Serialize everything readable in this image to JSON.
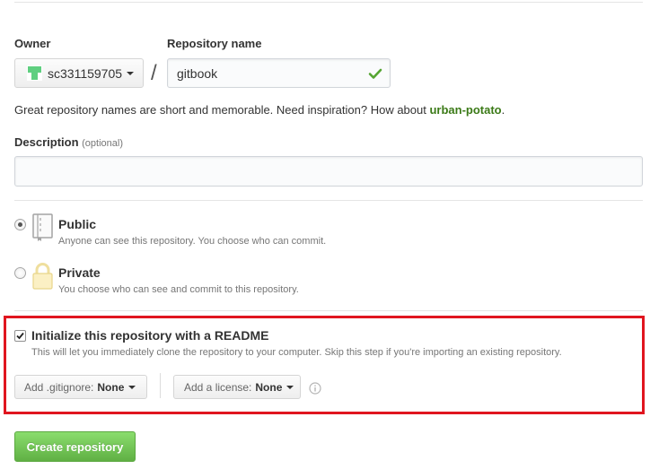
{
  "owner": {
    "label": "Owner",
    "selected": "sc331159705",
    "icon": "identicon-icon",
    "avatar_color": "#5fcf80"
  },
  "separator": "/",
  "repo_name": {
    "label": "Repository name",
    "value": "gitbook",
    "valid_icon": "check-icon",
    "valid_color": "#55a532"
  },
  "suggestion": {
    "text": "Great repository names are short and memorable. Need inspiration? How about ",
    "name": "urban-potato",
    "end": "."
  },
  "description": {
    "label": "Description",
    "optional": "(optional)",
    "value": ""
  },
  "visibility": {
    "public": {
      "title": "Public",
      "desc": "Anyone can see this repository. You choose who can commit.",
      "checked": true,
      "icon": "book-icon"
    },
    "private": {
      "title": "Private",
      "desc": "You choose who can see and commit to this repository.",
      "checked": false,
      "icon": "lock-icon"
    }
  },
  "readme": {
    "title": "Initialize this repository with a README",
    "desc": "This will let you immediately clone the repository to your computer. Skip this step if you're importing an existing repository.",
    "checked": true,
    "highlight_color": "#e0151f"
  },
  "gitignore": {
    "prefix": "Add .gitignore:",
    "value": "None"
  },
  "license": {
    "prefix": "Add a license:",
    "value": "None",
    "info_icon": "info-icon"
  },
  "submit": {
    "label": "Create repository",
    "color": "#60b044"
  }
}
